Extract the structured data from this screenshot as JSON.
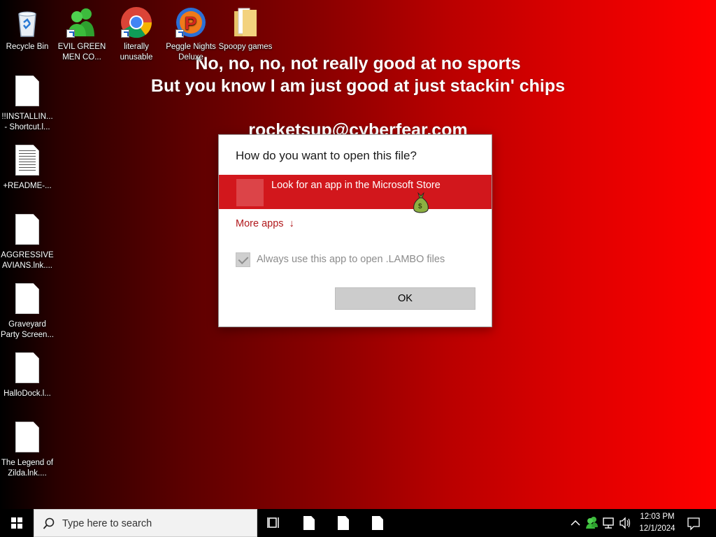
{
  "wallpaper": {
    "line1": "No, no, no, not really good at no sports",
    "line2": "But you know I am just good at just stackin' chips",
    "line3": "rocketsup@cyberfear.com"
  },
  "desktop_icons": [
    {
      "label": "Recycle Bin",
      "icon": "recycle-bin-icon"
    },
    {
      "label": "EVIL GREEN MEN CO...",
      "icon": "green-men-icon"
    },
    {
      "label": "literally unusable",
      "icon": "chrome-icon"
    },
    {
      "label": "Peggle Nights Deluxe",
      "icon": "peggle-icon"
    },
    {
      "label": "Spoopy games",
      "icon": "folder-icon"
    },
    {
      "label": "!!INSTALLIN... - Shortcut.l...",
      "icon": "file-icon"
    },
    {
      "label": "+README-...",
      "icon": "text-file-icon"
    },
    {
      "label": "AGGRESSIVE AVIANS.lnk....",
      "icon": "file-icon"
    },
    {
      "label": "Graveyard Party Screen...",
      "icon": "file-icon"
    },
    {
      "label": "HalloDock.l...",
      "icon": "file-icon"
    },
    {
      "label": "The Legend of Zilda.lnk....",
      "icon": "file-icon"
    }
  ],
  "dialog": {
    "title": "How do you want to open this file?",
    "store_option": "Look for an app in the Microsoft Store",
    "more_apps": "More apps",
    "more_apps_arrow": "↓",
    "always_use": "Always use this app to open .LAMBO files",
    "always_use_checked": true,
    "ok_label": "OK",
    "accent_color": "#d2171c"
  },
  "taskbar": {
    "search_placeholder": "Type here to search",
    "time": "12:03 PM",
    "date": "12/1/2024"
  }
}
